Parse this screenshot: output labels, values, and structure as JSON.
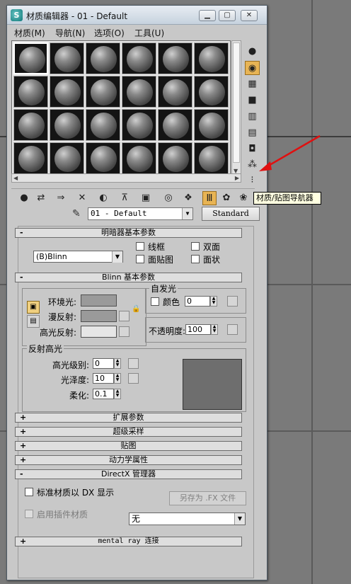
{
  "window": {
    "title": "材质编辑器 - 01 - Default"
  },
  "title_buttons": {
    "minimize": "▁",
    "maximize": "▢",
    "close": "✕"
  },
  "menu": {
    "items": [
      "材质(M)",
      "导航(N)",
      "选项(O)",
      "工具(U)"
    ]
  },
  "side_toolbar": {
    "tooltip": "材质/贴图导航器"
  },
  "name_row": {
    "material_name": "01 - Default",
    "material_type": "Standard"
  },
  "rollouts": {
    "shader_basic": "明暗器基本参数",
    "blinn_basic": "Blinn 基本参数",
    "extended": "扩展参数",
    "supersampling": "超级采样",
    "maps": "贴图",
    "dynamics": "动力学属性",
    "directx": "DirectX 管理器",
    "mental_ray": "mental ray 连接"
  },
  "shader": {
    "selected": "(B)Blinn",
    "wire": "线框",
    "two_sided": "双面",
    "face_map": "面贴图",
    "faceted": "面状"
  },
  "blinn": {
    "ambient": "环境光:",
    "diffuse": "漫反射:",
    "specular": "高光反射:",
    "self_illum_group": "自发光",
    "color_label": "颜色",
    "color_value": "0",
    "opacity_label": "不透明度:",
    "opacity_value": "100",
    "spec_group": "反射高光",
    "spec_level_label": "高光级别:",
    "spec_level_value": "0",
    "gloss_label": "光泽度:",
    "gloss_value": "10",
    "soften_label": "柔化:",
    "soften_value": "0.1"
  },
  "colors": {
    "ambient": "#9a9a9a",
    "diffuse": "#9a9a9a",
    "specular": "#e6e6e6",
    "highlight_preview": "#6e6e6e",
    "toggle_on": "#e8b454"
  },
  "directx": {
    "display_label": "标准材质以 DX 显示",
    "save_fx": "另存为 .FX 文件",
    "plugin_label": "启用插件材质",
    "plugin_value": "无"
  },
  "icons": {
    "side": [
      "sample-sphere-icon",
      "backlight-icon",
      "checker-background-icon",
      "sample-uv-icon",
      "video-color-check-icon",
      "make-preview-icon",
      "options-icon",
      "select-by-material-icon",
      "material-map-navigator-icon"
    ],
    "tools": [
      "get-material-icon",
      "put-to-scene-icon",
      "assign-to-selection-icon",
      "reset-map-icon",
      "make-copy-icon",
      "unique-icon",
      "put-to-library-icon",
      "material-id-icon",
      "show-map-icon",
      "show-end-result-icon",
      "go-to-parent-icon",
      "go-forward-sibling-icon"
    ]
  }
}
